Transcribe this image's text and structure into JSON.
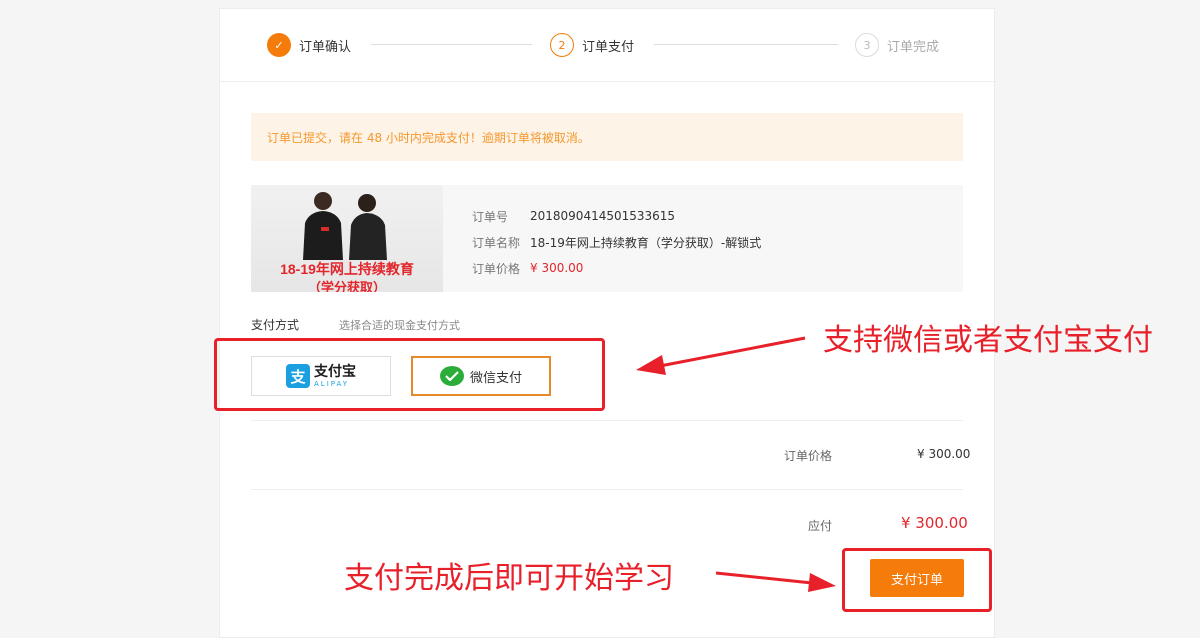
{
  "steps": [
    {
      "number": "✓",
      "label": "订单确认"
    },
    {
      "number": "2",
      "label": "订单支付"
    },
    {
      "number": "3",
      "label": "订单完成"
    }
  ],
  "notice": "订单已提交，请在 48 小时内完成支付！逾期订单将被取消。",
  "course_image": {
    "title_line1": "18-19年网上持续教育",
    "title_line2": "（学分获取）"
  },
  "order": {
    "rows": [
      {
        "key": "订单号",
        "value": "2018090414501533615"
      },
      {
        "key": "订单名称",
        "value": "18-19年网上持续教育（学分获取）-解锁式"
      },
      {
        "key": "订单价格",
        "value": "¥ 300.00"
      }
    ]
  },
  "payment": {
    "title": "支付方式",
    "subtitle": "选择合适的现金支付方式",
    "alipay": {
      "icon": "支",
      "cn": "支付宝",
      "en": "ALIPAY"
    },
    "wechat": {
      "label": "微信支付"
    }
  },
  "summary": {
    "price_label": "订单价格",
    "price_value": "¥ 300.00",
    "due_label": "应付",
    "due_value": "¥ 300.00"
  },
  "submit_label": "支付订单",
  "annotations": {
    "payment_methods": "支持微信或者支付宝支付",
    "after_pay": "支付完成后即可开始学习"
  },
  "colors": {
    "accent": "#f57b0b",
    "price": "#e3262c",
    "annotation": "#e8202a"
  }
}
